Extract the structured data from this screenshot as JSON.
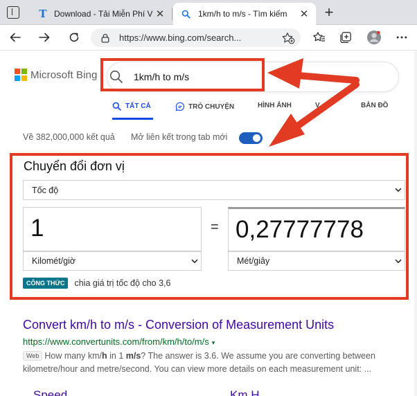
{
  "browser": {
    "tabs": [
      {
        "title": "Download - Tải Miễn Phí VN - ",
        "favicon": "t-logo-icon",
        "active": false
      },
      {
        "title": "1km/h to m/s - Tìm kiếm",
        "favicon": "search-icon",
        "active": true
      }
    ],
    "address_url": "https://www.bing.com/search..."
  },
  "bing": {
    "logo_text": "Microsoft Bing",
    "search_query": "1km/h to m/s",
    "scopes": [
      "TẤT CẢ",
      "TRÒ CHUYỆN",
      "HÌNH ẢNH",
      "V",
      "BẢN ĐỒ"
    ],
    "results_count": "Về 382,000,000 kết quả",
    "new_tab_label": "Mở liên kết trong tab mới",
    "new_tab_enabled": true
  },
  "converter": {
    "title": "Chuyển đổi đơn vị",
    "category": "Tốc độ",
    "input_value": "1",
    "equals": "=",
    "output_value": "0,27777778",
    "from_unit": "Kilomét/giờ",
    "to_unit": "Mét/giây",
    "formula_badge": "CÔNG THỨC",
    "formula_text": "chia giá trị tốc độ cho 3,6"
  },
  "result": {
    "title": "Convert km/h to m/s - Conversion of Measurement Units",
    "url": "https://www.convertunits.com/from/km/h/to/m/s",
    "url_caret": "▾",
    "badge": "Web",
    "snippet_1": "How many km/",
    "snippet_2": "h",
    "snippet_3": " in 1 ",
    "snippet_4": "m/s",
    "snippet_5": "? The answer is 3.6. We assume you are converting between kilometre/hour and metre/second. You can view more details on each measurement unit: ...",
    "deep_link_1": "Speed",
    "deep_link_2": "Km H"
  },
  "colors": {
    "annotation_red": "#e23b24",
    "bing_blue": "#174ae4",
    "link_purple": "#4007a2",
    "url_green": "#006d21",
    "formula_teal": "#08758a"
  }
}
